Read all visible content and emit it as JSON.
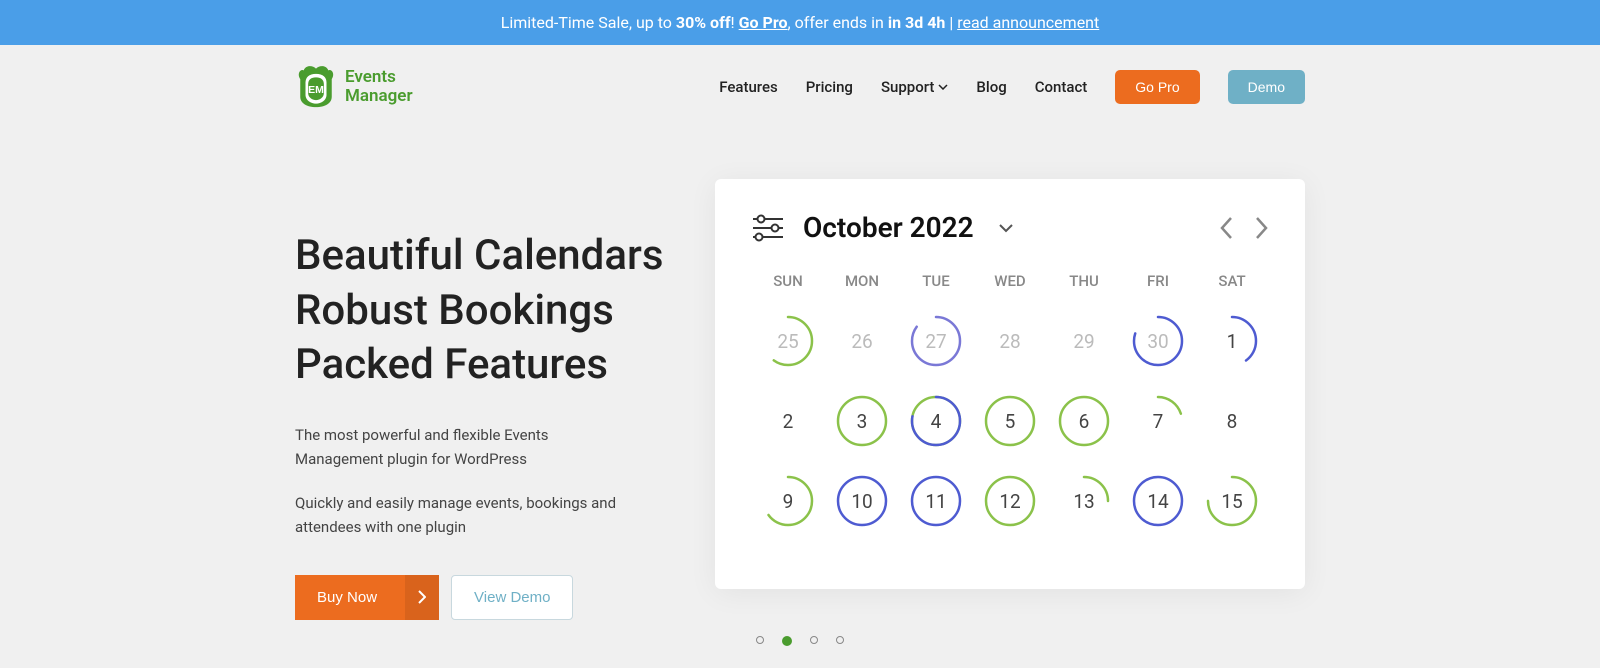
{
  "announcement": {
    "prefix": "Limited-Time Sale, up to ",
    "discount": "30% off",
    "exclaim": "! ",
    "go_pro": "Go Pro",
    "mid": ", offer ends in ",
    "countdown": "in 3d 4h",
    "sep": " | ",
    "read": "read announcement"
  },
  "logo": {
    "line1": "Events",
    "line2": "Manager"
  },
  "nav": {
    "features": "Features",
    "pricing": "Pricing",
    "support": "Support",
    "blog": "Blog",
    "contact": "Contact",
    "gopro": "Go Pro",
    "demo": "Demo"
  },
  "hero": {
    "title_line1": "Beautiful Calendars",
    "title_line2": "Robust Bookings",
    "title_line3": "Packed Features",
    "desc1": "The most powerful and flexible Events Management plugin for WordPress",
    "desc2": "Quickly and easily manage events, bookings and attendees with one plugin",
    "buy": "Buy Now",
    "viewdemo": "View Demo"
  },
  "calendar": {
    "month": "October 2022",
    "day_headers": [
      "SUN",
      "MON",
      "TUE",
      "WED",
      "THU",
      "FRI",
      "SAT"
    ],
    "cells": [
      {
        "n": "25",
        "muted": true,
        "ring": "partial",
        "color": "#8bc24a",
        "pct": 60
      },
      {
        "n": "26",
        "muted": true,
        "ring": "none"
      },
      {
        "n": "27",
        "muted": true,
        "ring": "partial",
        "color": "#7a78d6",
        "pct": 85
      },
      {
        "n": "28",
        "muted": true,
        "ring": "none"
      },
      {
        "n": "29",
        "muted": true,
        "ring": "none"
      },
      {
        "n": "30",
        "muted": true,
        "ring": "partial",
        "color": "#4e5bd1",
        "pct": 80
      },
      {
        "n": "1",
        "muted": false,
        "ring": "partial",
        "color": "#4e5bd1",
        "pct": 40
      },
      {
        "n": "2",
        "muted": false,
        "ring": "none"
      },
      {
        "n": "3",
        "muted": false,
        "ring": "full",
        "color": "#8bc24a"
      },
      {
        "n": "4",
        "muted": false,
        "ring": "partial",
        "color": "#4e5bd1",
        "pct": 78,
        "second": "#8bc24a"
      },
      {
        "n": "5",
        "muted": false,
        "ring": "full",
        "color": "#8bc24a"
      },
      {
        "n": "6",
        "muted": false,
        "ring": "full",
        "color": "#8bc24a"
      },
      {
        "n": "7",
        "muted": false,
        "ring": "partial",
        "color": "#8bc24a",
        "pct": 20
      },
      {
        "n": "8",
        "muted": false,
        "ring": "none"
      },
      {
        "n": "9",
        "muted": false,
        "ring": "partial",
        "color": "#8bc24a",
        "pct": 65
      },
      {
        "n": "10",
        "muted": false,
        "ring": "full",
        "color": "#4e5bd1"
      },
      {
        "n": "11",
        "muted": false,
        "ring": "full",
        "color": "#4e5bd1"
      },
      {
        "n": "12",
        "muted": false,
        "ring": "full",
        "color": "#8bc24a"
      },
      {
        "n": "13",
        "muted": false,
        "ring": "partial",
        "color": "#8bc24a",
        "pct": 25
      },
      {
        "n": "14",
        "muted": false,
        "ring": "full",
        "color": "#4e5bd1"
      },
      {
        "n": "15",
        "muted": false,
        "ring": "partial",
        "color": "#8bc24a",
        "pct": 75
      }
    ]
  },
  "slider": {
    "active_index": 1,
    "count": 4
  }
}
